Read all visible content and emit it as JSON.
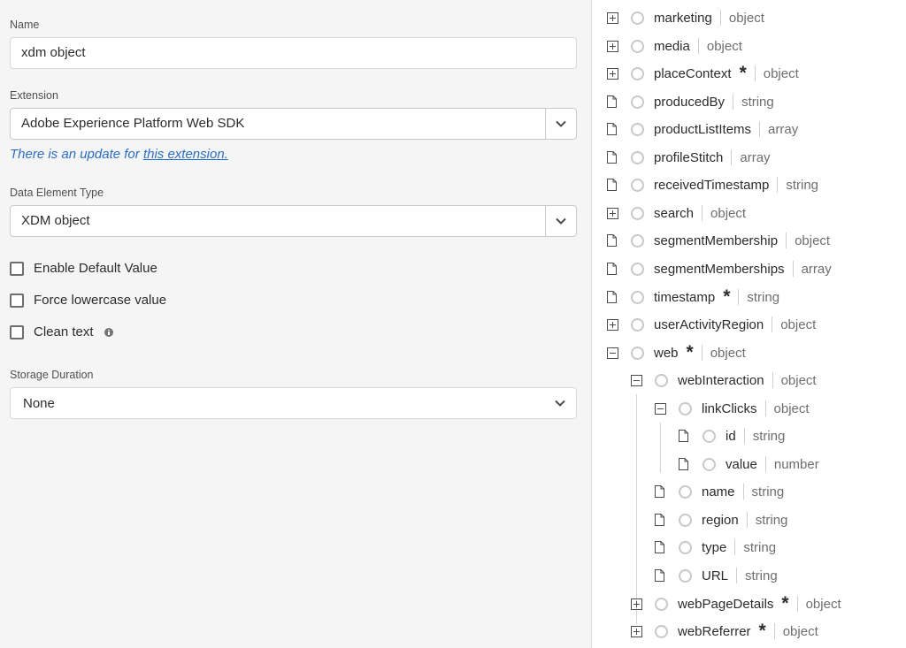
{
  "form": {
    "name_label": "Name",
    "name_value": "xdm object",
    "extension_label": "Extension",
    "extension_value": "Adobe Experience Platform Web SDK",
    "update_prefix": "There is an update for",
    "update_link": "this extension.",
    "type_label": "Data Element Type",
    "type_value": "XDM object",
    "checkboxes": [
      {
        "label": "Enable Default Value",
        "checked": false
      },
      {
        "label": "Force lowercase value",
        "checked": false
      },
      {
        "label": "Clean text",
        "checked": false
      }
    ],
    "storage_label": "Storage Duration",
    "storage_value": "None"
  },
  "tree": [
    {
      "name": "marketing",
      "type": "object",
      "node": "collapsed",
      "required": false,
      "level": 0
    },
    {
      "name": "media",
      "type": "object",
      "node": "collapsed",
      "required": false,
      "level": 0
    },
    {
      "name": "placeContext",
      "type": "object",
      "node": "collapsed",
      "required": true,
      "level": 0
    },
    {
      "name": "producedBy",
      "type": "string",
      "node": "leaf",
      "required": false,
      "level": 0
    },
    {
      "name": "productListItems",
      "type": "array",
      "node": "leaf",
      "required": false,
      "level": 0
    },
    {
      "name": "profileStitch",
      "type": "array",
      "node": "leaf",
      "required": false,
      "level": 0
    },
    {
      "name": "receivedTimestamp",
      "type": "string",
      "node": "leaf",
      "required": false,
      "level": 0
    },
    {
      "name": "search",
      "type": "object",
      "node": "collapsed",
      "required": false,
      "level": 0
    },
    {
      "name": "segmentMembership",
      "type": "object",
      "node": "leaf",
      "required": false,
      "level": 0
    },
    {
      "name": "segmentMemberships",
      "type": "array",
      "node": "leaf",
      "required": false,
      "level": 0
    },
    {
      "name": "timestamp",
      "type": "string",
      "node": "leaf",
      "required": true,
      "level": 0
    },
    {
      "name": "userActivityRegion",
      "type": "object",
      "node": "collapsed",
      "required": false,
      "level": 0
    },
    {
      "name": "web",
      "type": "object",
      "node": "expanded",
      "required": true,
      "level": 0
    },
    {
      "name": "webInteraction",
      "type": "object",
      "node": "expanded",
      "required": false,
      "level": 1
    },
    {
      "name": "linkClicks",
      "type": "object",
      "node": "expanded",
      "required": false,
      "level": 2
    },
    {
      "name": "id",
      "type": "string",
      "node": "leaf",
      "required": false,
      "level": 3
    },
    {
      "name": "value",
      "type": "number",
      "node": "leaf",
      "required": false,
      "level": 3
    },
    {
      "name": "name",
      "type": "string",
      "node": "leaf",
      "required": false,
      "level": 2
    },
    {
      "name": "region",
      "type": "string",
      "node": "leaf",
      "required": false,
      "level": 2
    },
    {
      "name": "type",
      "type": "string",
      "node": "leaf",
      "required": false,
      "level": 2
    },
    {
      "name": "URL",
      "type": "string",
      "node": "leaf",
      "required": false,
      "level": 2
    },
    {
      "name": "webPageDetails",
      "type": "object",
      "node": "collapsed",
      "required": true,
      "level": 1
    },
    {
      "name": "webReferrer",
      "type": "object",
      "node": "collapsed",
      "required": true,
      "level": 1
    }
  ]
}
